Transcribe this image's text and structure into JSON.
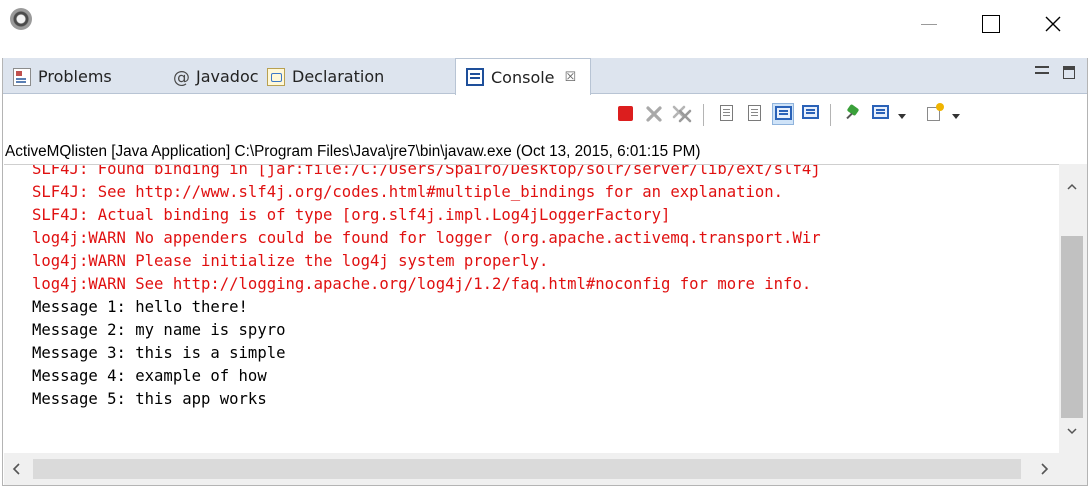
{
  "window": {
    "minimize_icon": "minimize-icon",
    "maximize_icon": "maximize-icon",
    "close_icon": "close-icon"
  },
  "tabs": [
    {
      "label": "Problems",
      "icon": "problems-icon"
    },
    {
      "label": "Javadoc",
      "icon": "at-icon",
      "glyph": "@"
    },
    {
      "label": "Declaration",
      "icon": "declaration-icon"
    },
    {
      "label": "Console",
      "icon": "console-icon",
      "active": true,
      "close_glyph": "☒"
    }
  ],
  "toolbar": [
    {
      "name": "terminate",
      "icon": "stop-icon",
      "color": "#dc1e1e"
    },
    {
      "name": "remove-launch",
      "icon": "remove-icon"
    },
    {
      "name": "remove-all-terminated",
      "icon": "remove-all-icon"
    },
    {
      "name": "clear-console",
      "icon": "clear-icon"
    },
    {
      "name": "scroll-lock",
      "icon": "scroll-lock-icon"
    },
    {
      "name": "show-on-stdout",
      "icon": "console-out-icon",
      "pressed": true
    },
    {
      "name": "show-on-stderr",
      "icon": "console-err-icon"
    },
    {
      "name": "pin-console",
      "icon": "pin-icon"
    },
    {
      "name": "display-console",
      "icon": "display-icon"
    },
    {
      "name": "open-console",
      "icon": "new-console-icon"
    }
  ],
  "console": {
    "process_label": "ActiveMQlisten [Java Application] C:\\Program Files\\Java\\jre7\\bin\\javaw.exe (Oct 13, 2015, 6:01:15 PM)",
    "lines": [
      {
        "text": "SLF4J: Found binding in [jar:file:/C:/Users/Spairo/Desktop/solr/server/lib/ext/slf4j",
        "type": "err"
      },
      {
        "text": "SLF4J: See http://www.slf4j.org/codes.html#multiple_bindings for an explanation.",
        "type": "err"
      },
      {
        "text": "SLF4J: Actual binding is of type [org.slf4j.impl.Log4jLoggerFactory]",
        "type": "err"
      },
      {
        "text": "log4j:WARN No appenders could be found for logger (org.apache.activemq.transport.Wir",
        "type": "err"
      },
      {
        "text": "log4j:WARN Please initialize the log4j system properly.",
        "type": "err"
      },
      {
        "text": "log4j:WARN See http://logging.apache.org/log4j/1.2/faq.html#noconfig for more info.",
        "type": "err"
      },
      {
        "text": "Message 1: hello there!",
        "type": "out"
      },
      {
        "text": "Message 2: my name is spyro",
        "type": "out"
      },
      {
        "text": "Message 3: this is a simple",
        "type": "out"
      },
      {
        "text": "Message 4: example of how",
        "type": "out"
      },
      {
        "text": "Message 5: this app works",
        "type": "out"
      }
    ],
    "stderr_color": "#e01010",
    "stdout_color": "#000000"
  }
}
